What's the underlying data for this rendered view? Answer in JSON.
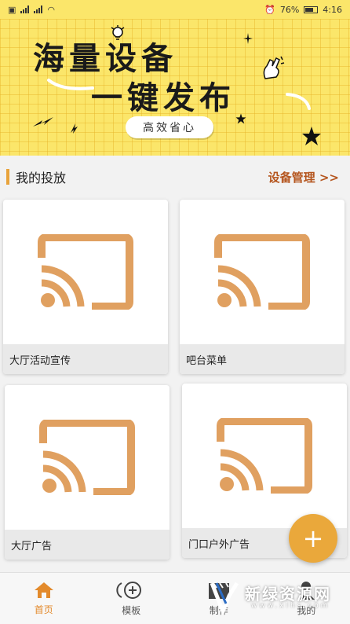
{
  "status_bar": {
    "battery": "76%",
    "time": "4:16"
  },
  "banner": {
    "title_line1": "海量设备",
    "title_line2": "一键发布",
    "pill": "高效省心"
  },
  "section": {
    "title": "我的投放",
    "link": "设备管理 >>"
  },
  "cards": [
    {
      "label": "大厅活动宣传"
    },
    {
      "label": "吧台菜单"
    },
    {
      "label": "大厅广告"
    },
    {
      "label": "门口户外广告"
    }
  ],
  "fab": {
    "icon": "plus-icon",
    "symbol": "+"
  },
  "nav": {
    "items": [
      {
        "label": "首页",
        "icon": "home-icon",
        "active": true
      },
      {
        "label": "模板",
        "icon": "template-icon",
        "active": false
      },
      {
        "label": "制作",
        "icon": "clapper-icon",
        "active": false
      },
      {
        "label": "我的",
        "icon": "user-icon",
        "active": false
      }
    ]
  },
  "watermark": {
    "text": "新绿资源网",
    "sub": "www.xlhs.com"
  },
  "colors": {
    "accent": "#e8a33b",
    "banner_bg": "#fbe66a",
    "link": "#b5561f",
    "cast_icon": "#e0a060"
  }
}
